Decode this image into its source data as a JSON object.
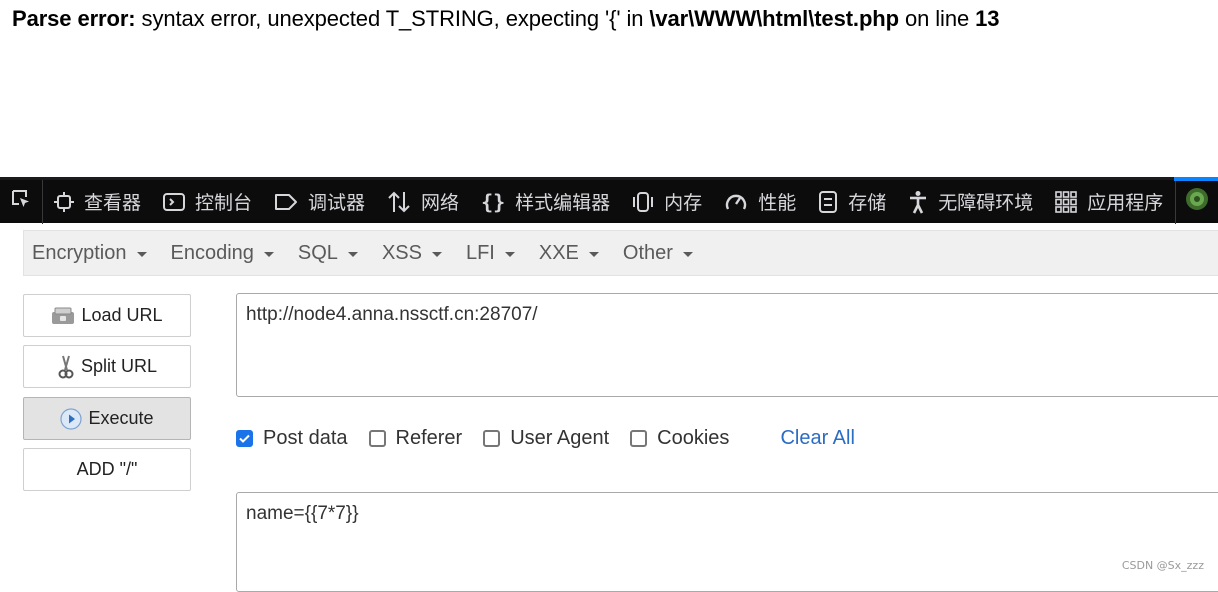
{
  "error": {
    "prefix": "Parse error:",
    "message": " syntax error, unexpected T_STRING, expecting '{' in ",
    "path": "\\var\\WWW\\html\\test.php",
    "on_line": " on line ",
    "line": "13"
  },
  "devtools": {
    "tabs": [
      {
        "label": "查看器",
        "icon": "inspector-icon"
      },
      {
        "label": "控制台",
        "icon": "console-icon"
      },
      {
        "label": "调试器",
        "icon": "debugger-icon"
      },
      {
        "label": "网络",
        "icon": "network-icon"
      },
      {
        "label": "样式编辑器",
        "icon": "style-editor-icon"
      },
      {
        "label": "内存",
        "icon": "memory-icon"
      },
      {
        "label": "性能",
        "icon": "performance-icon"
      },
      {
        "label": "存储",
        "icon": "storage-icon"
      },
      {
        "label": "无障碍环境",
        "icon": "accessibility-icon"
      },
      {
        "label": "应用程序",
        "icon": "application-icon"
      }
    ]
  },
  "hackbar": {
    "menus": [
      "Encryption",
      "Encoding",
      "SQL",
      "XSS",
      "LFI",
      "XXE",
      "Other"
    ],
    "buttons": {
      "load_url": "Load URL",
      "split_url": "Split URL",
      "execute": "Execute",
      "add_slash": "ADD \"/\""
    },
    "url": "http://node4.anna.nssctf.cn:28707/",
    "options": {
      "post_data": "Post data",
      "referer": "Referer",
      "user_agent": "User Agent",
      "cookies": "Cookies",
      "clear_all": "Clear All"
    },
    "post_body": "name={{7*7}}"
  },
  "watermark": "CSDN @Sx_zzz",
  "colors": {
    "accent": "#0a84ff",
    "checkbox": "#1a73e8",
    "link": "#2b6cc4"
  }
}
